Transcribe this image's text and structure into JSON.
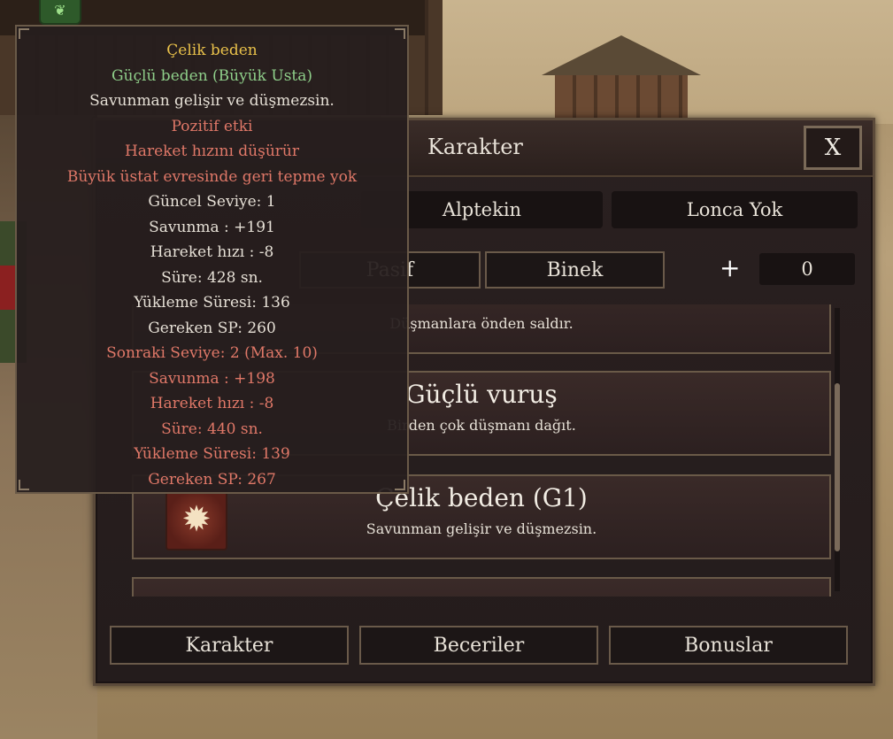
{
  "window": {
    "title": "Karakter",
    "close_label": "X",
    "character_name": "Alptekin",
    "guild": "Lonca Yok"
  },
  "tabs": {
    "pasif": "Pasif",
    "binek": "Binek"
  },
  "skill_points": {
    "plus": "+",
    "value": "0"
  },
  "skills": [
    {
      "name": "Güçlü vuruş",
      "desc": "Birden çok düşmanı dağıt."
    },
    {
      "name": "Çelik beden (G1)",
      "desc": "Savunman gelişir ve düşmezsin."
    }
  ],
  "partial_skill_desc": "Düşmanlara önden saldır.",
  "bottom": {
    "karakter": "Karakter",
    "beceriler": "Beceriler",
    "bonuslar": "Bonuslar"
  },
  "tooltip": {
    "title": "Çelik beden",
    "rank": "Güçlü beden (Büyük Usta)",
    "desc": "Savunman gelişir ve düşmezsin.",
    "effect_type": "Pozitif etki",
    "effect1": "Hareket hızını düşürür",
    "effect2": "Büyük üstat evresinde geri tepme yok",
    "current_level": "Güncel Seviye: 1",
    "cur_defense": "Savunma : +191",
    "cur_speed": "Hareket hızı : -8",
    "cur_duration": "Süre: 428 sn.",
    "cur_cooldown": "Yükleme Süresi: 136",
    "cur_sp": "Gereken SP: 260",
    "next_level": "Sonraki Seviye: 2 (Max. 10)",
    "next_defense": "Savunma : +198",
    "next_speed": "Hareket hızı : -8",
    "next_duration": "Süre: 440 sn.",
    "next_cooldown": "Yükleme Süresi: 139",
    "next_sp": "Gereken SP: 267"
  },
  "colors": {
    "gold": "#e8c04a",
    "green": "#8fcf8a",
    "red": "#e07868",
    "panel": "#2a2020"
  }
}
